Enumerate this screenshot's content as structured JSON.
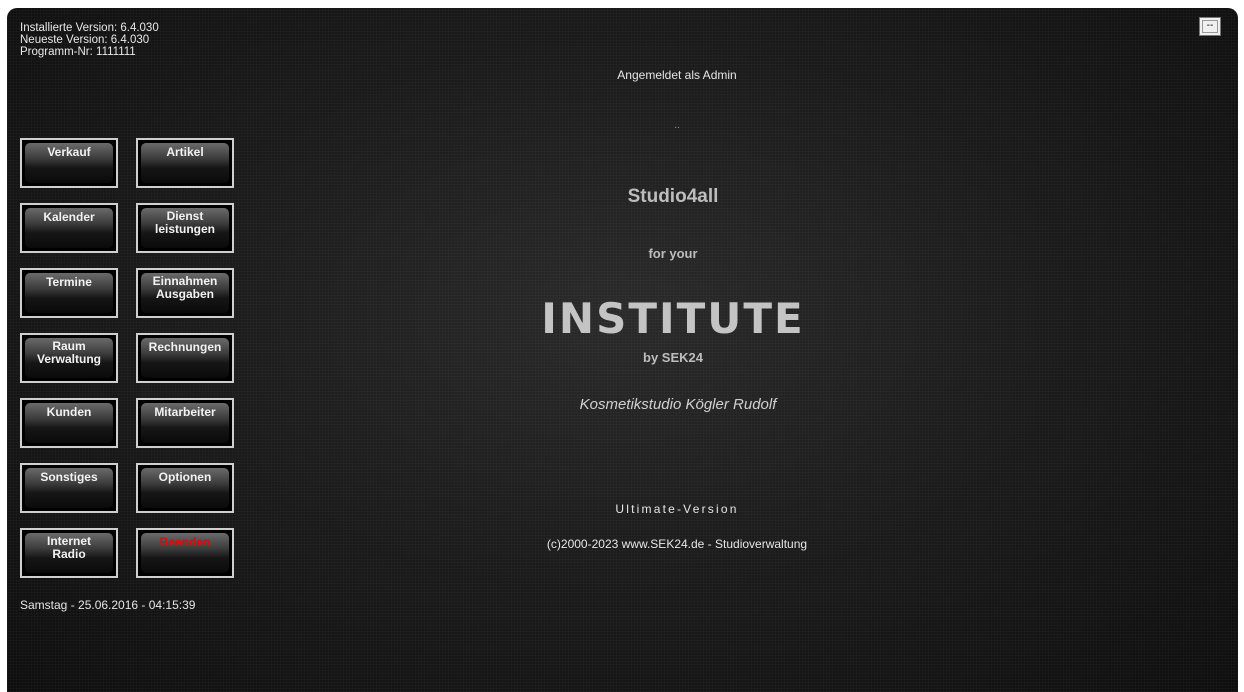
{
  "info": {
    "installed": "Installierte Version: 6.4.030",
    "latest": "Neueste Version: 6.4.030",
    "program": "Programm-Nr: 1111111"
  },
  "top_button": "--",
  "login_status": "Angemeldet als Admin",
  "dots": "..",
  "brand": {
    "title": "Studio4all",
    "for_your": "for your",
    "institute": "INSTITUTE",
    "by": "by SEK24",
    "studio_name": "Kosmetikstudio Kögler Rudolf",
    "edition": "Ultimate-Version",
    "copyright": "(c)2000-2023 www.SEK24.de  -  Studioverwaltung"
  },
  "buttons": {
    "verkauf": "Verkauf",
    "artikel": "Artikel",
    "kalender": "Kalender",
    "dienstleistungen": "Dienst\nleistungen",
    "termine": "Termine",
    "einnahmen": "Einnahmen\nAusgaben",
    "raumverwaltung": "Raum\nVerwaltung",
    "rechnungen": "Rechnungen",
    "kunden": "Kunden",
    "mitarbeiter": "Mitarbeiter",
    "sonstiges": "Sonstiges",
    "optionen": "Optionen",
    "internetradio": "Internet\nRadio",
    "beenden": "Beenden"
  },
  "datetime": "Samstag - 25.06.2016 - 04:15:39",
  "colors": {
    "exit_text": "#d10f0f"
  }
}
